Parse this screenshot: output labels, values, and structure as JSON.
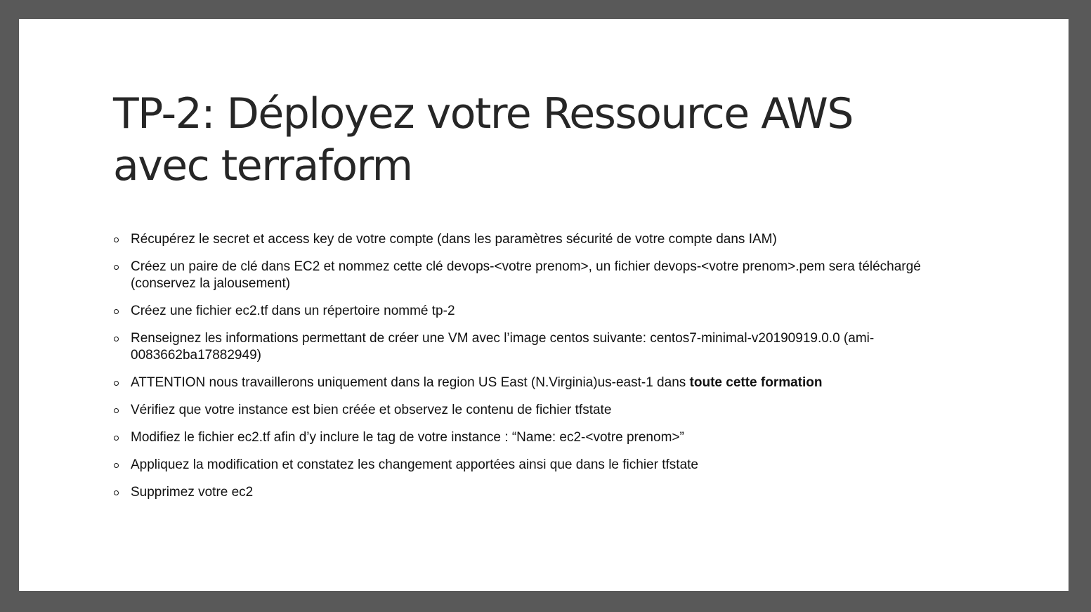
{
  "slide": {
    "title_line1": "TP-2: Déployez votre Ressource AWS",
    "title_line2": "avec terraform",
    "bullets": [
      "Récupérez le secret et access key de votre compte (dans les paramètres sécurité de votre compte dans IAM)",
      "Créez un paire de clé dans EC2 et nommez cette clé devops-<votre prenom>, un fichier devops-<votre prenom>.pem sera téléchargé (conservez la jalousement)",
      "Créez une fichier ec2.tf dans un répertoire nommé tp-2",
      "Renseignez les informations permettant de créer une VM avec l’image centos suivante: centos7-minimal-v20190919.0.0 (ami-0083662ba17882949)",
      "ATTENTION nous travaillerons uniquement dans la region US East (N.Virginia)us-east-1 dans ",
      "Vérifiez que votre instance est bien créée et observez le contenu de fichier tfstate",
      "Modifiez le fichier ec2.tf afin d’y inclure le tag de votre instance : “Name: ec2-<votre prenom>”",
      "Appliquez la modification et constatez les changement apportées ainsi que dans le fichier tfstate",
      "Supprimez votre ec2"
    ],
    "bullet5_bold": "toute cette formation"
  }
}
